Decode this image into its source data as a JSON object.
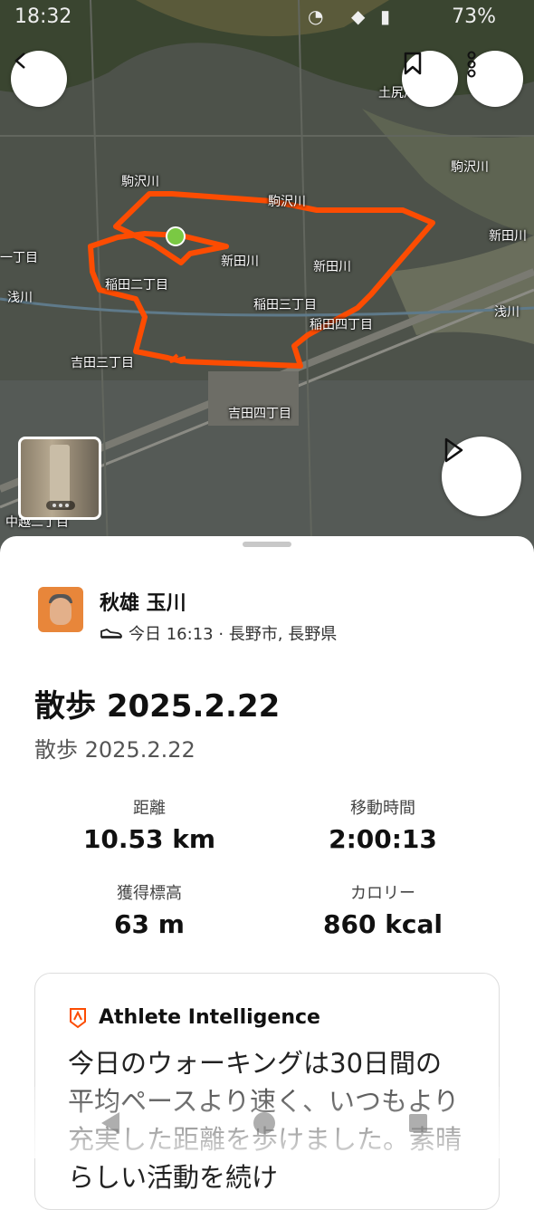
{
  "status_bar": {
    "time": "18:32",
    "battery": "73%"
  },
  "map": {
    "labels": [
      {
        "key": "komazawa1",
        "text": "駒沢川"
      },
      {
        "key": "komazawa2",
        "text": "駒沢川"
      },
      {
        "key": "komazawa3",
        "text": "駒沢川"
      },
      {
        "key": "shinden1",
        "text": "新田川"
      },
      {
        "key": "shinden2",
        "text": "新田川"
      },
      {
        "key": "shinden3",
        "text": "新田川"
      },
      {
        "key": "inada2",
        "text": "稲田二丁目"
      },
      {
        "key": "inada3",
        "text": "稲田三丁目"
      },
      {
        "key": "inada4",
        "text": "稲田四丁目"
      },
      {
        "key": "yoshida3",
        "text": "吉田三丁目"
      },
      {
        "key": "yoshida4",
        "text": "吉田四丁目"
      },
      {
        "key": "asakawa1",
        "text": "浅川"
      },
      {
        "key": "asakawa2",
        "text": "浅川"
      },
      {
        "key": "ichome",
        "text": "一丁目"
      },
      {
        "key": "nakagoe",
        "text": "中越二丁目"
      },
      {
        "key": "dosha",
        "text": "土尻川"
      }
    ]
  },
  "user": {
    "name": "秋雄 玉川",
    "meta": "今日 16:13 · 長野市, 長野県"
  },
  "activity": {
    "title": "散歩 2025.2.22",
    "subtitle": "散歩 2025.2.22",
    "stats": [
      {
        "label": "距離",
        "value": "10.53 km"
      },
      {
        "label": "移動時間",
        "value": "2:00:13"
      },
      {
        "label": "獲得標高",
        "value": "63 m"
      },
      {
        "label": "カロリー",
        "value": "860 kcal"
      }
    ]
  },
  "insight": {
    "heading": "Athlete Intelligence",
    "text": "今日のウォーキングは30日間の平均ペースより速く、いつもより充実した距離を歩けました。素晴らしい活動を続け"
  },
  "colors": {
    "route": "#fc4c02",
    "start_dot": "#7ac943"
  }
}
